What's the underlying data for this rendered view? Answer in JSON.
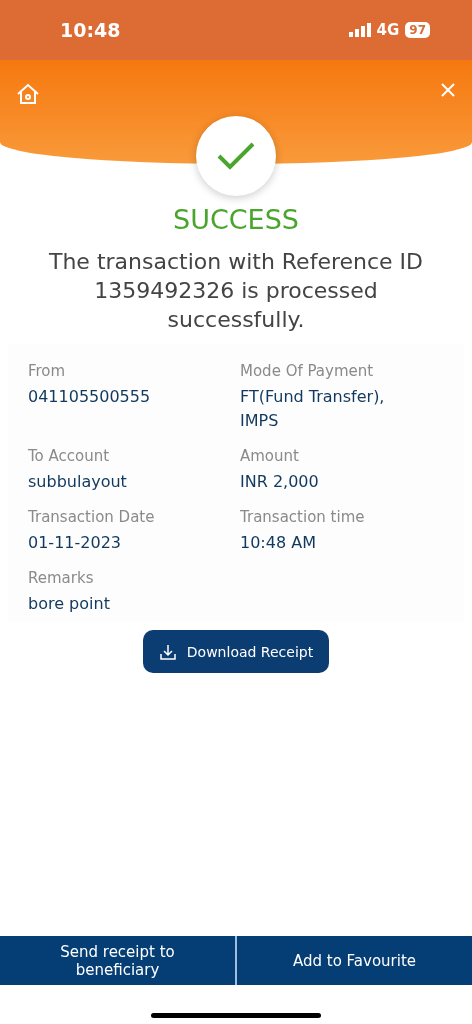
{
  "status_bar": {
    "time": "10:48",
    "network": "4G",
    "battery": "97"
  },
  "result": {
    "success": true,
    "title": "SUCCESS",
    "message": "The transaction with Reference ID 1359492326 is processed successfully."
  },
  "details": [
    {
      "label": "From",
      "value": "041105500555"
    },
    {
      "label": "Mode Of Payment",
      "value": "FT(Fund Transfer), IMPS"
    },
    {
      "label": "To Account",
      "value": "subbulayout"
    },
    {
      "label": "Amount",
      "value": "INR 2,000"
    },
    {
      "label": "Transaction Date",
      "value": "01-11-2023"
    },
    {
      "label": "Transaction time",
      "value": "10:48 AM"
    },
    {
      "label": "Remarks",
      "value": "bore point"
    }
  ],
  "download_button": "Download Receipt",
  "bottom_buttons": [
    "Send receipt to beneficiary",
    "Add to Favourite"
  ]
}
